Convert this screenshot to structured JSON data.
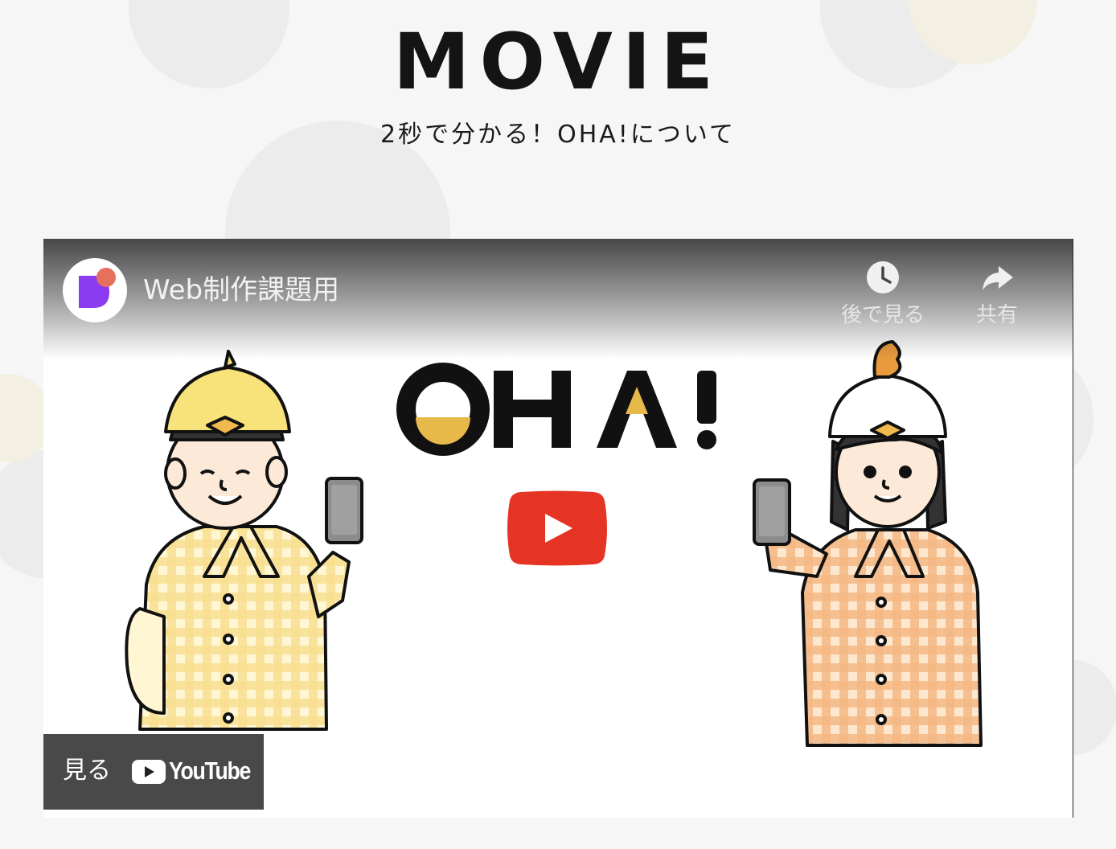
{
  "section": {
    "title": "MOVIE",
    "subtitle": "2秒で分かる！OHA!について",
    "background_watermark": "OHA!"
  },
  "player": {
    "video_title": "Web制作課題用",
    "channel_avatar_icon": "channel-logo-icon",
    "actions": [
      {
        "label": "後で見る",
        "icon": "clock-icon"
      },
      {
        "label": "共有",
        "icon": "share-arrow-icon"
      }
    ],
    "thumbnail_logo": "OHA!",
    "play_icon": "youtube-play-icon",
    "watch_on": {
      "label": "見る",
      "brand": "YouTube"
    }
  },
  "colors": {
    "background": "#f6f6f6",
    "title": "#141414",
    "oha_yellow": "#e6b94a",
    "play_red": "#e53424",
    "left_shirt": "#f5d77a",
    "right_shirt": "#f2b47a",
    "avatar_purple": "#8b3cf0",
    "avatar_coral": "#e6705e"
  }
}
